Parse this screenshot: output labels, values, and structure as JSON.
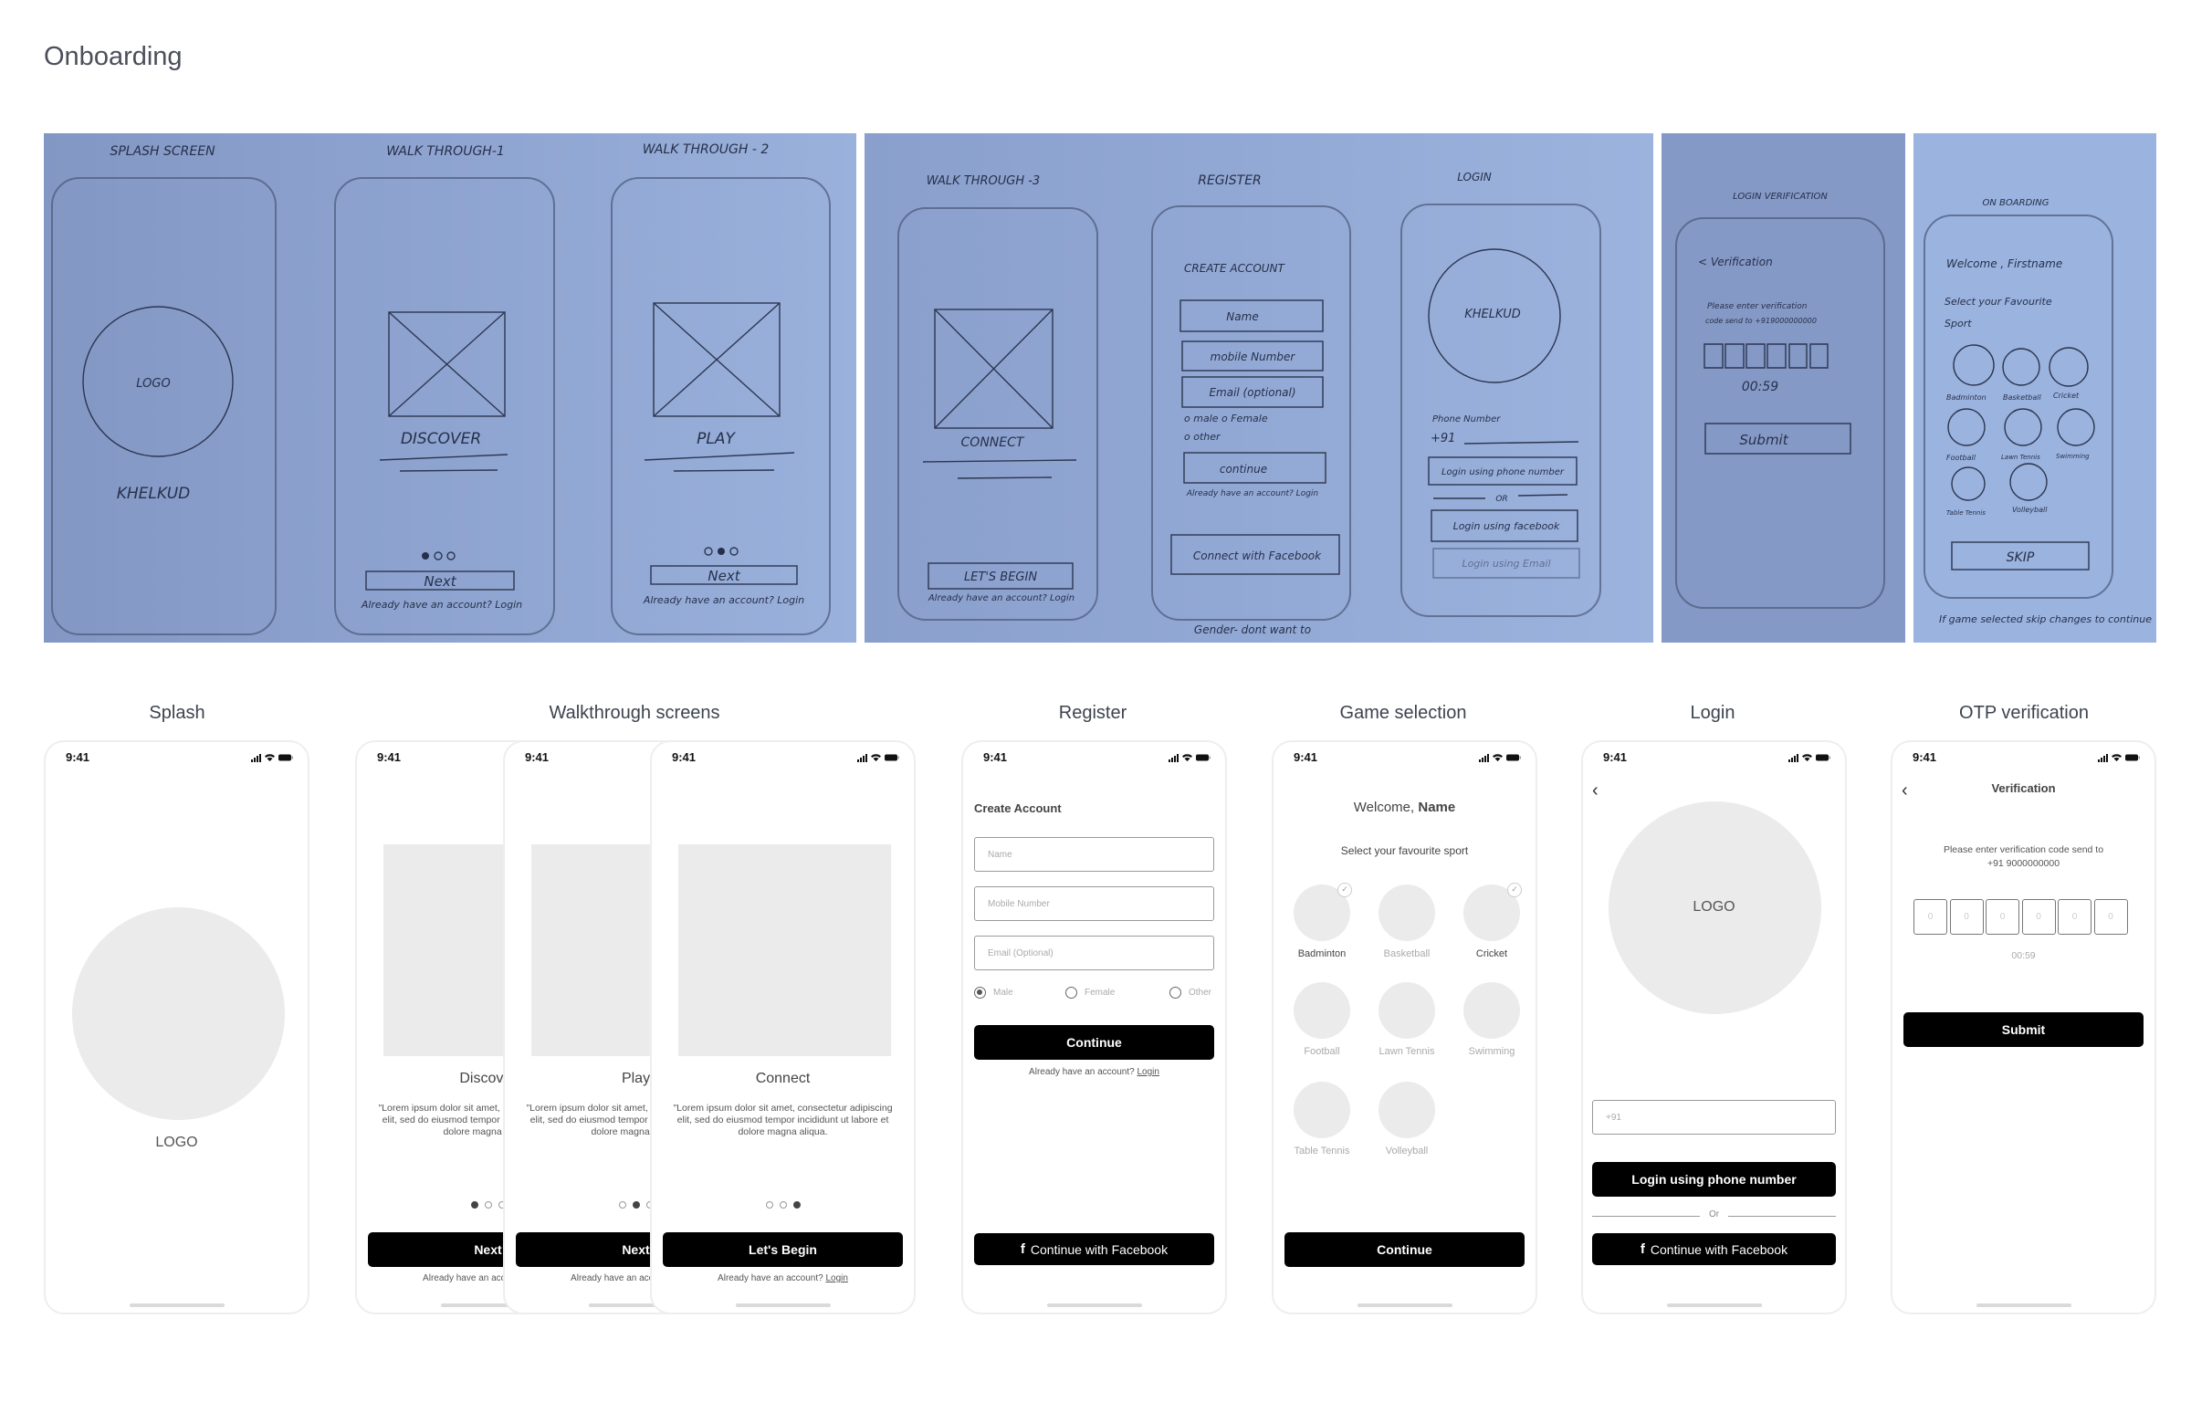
{
  "page_title": "Onboarding",
  "sketches": {
    "panel1": {
      "splash": {
        "title": "SPLASH SCREEN",
        "logo": "LOGO",
        "brand": "KHELKUD"
      },
      "walk1": {
        "title": "WALK THROUGH-1",
        "heading": "DISCOVER",
        "button": "Next",
        "footer": "Already have an account? Login"
      },
      "walk2": {
        "title": "WALK THROUGH - 2",
        "heading": "PLAY",
        "button": "Next",
        "footer": "Already have an account? Login"
      }
    },
    "panel2": {
      "walk3": {
        "title": "WALK THROUGH -3",
        "heading": "CONNECT",
        "button": "LET'S BEGIN",
        "footer": "Already have an account? Login"
      },
      "register": {
        "title": "REGISTER",
        "heading": "CREATE ACCOUNT",
        "name": "Name",
        "mobile": "mobile Number",
        "email": "Email (optional)",
        "gender1": "o male    o Female",
        "gender2": "o other",
        "continue": "continue",
        "footer": "Already have an account? Login",
        "facebook": "Connect with Facebook",
        "note": "Gender- dont want to"
      },
      "login": {
        "title": "LOGIN",
        "brand": "KHELKUD",
        "phone_label": "Phone Number",
        "prefix": "+91",
        "phone_button": "Login using phone number",
        "or": "OR",
        "facebook": "Login using facebook",
        "email": "Login using Email"
      }
    },
    "panel3": {
      "title": "LOGIN VERIFICATION",
      "heading": "< Verification",
      "line1": "Please enter verification",
      "line2": "code send to +919000000000",
      "timer": "00:59",
      "button": "Submit"
    },
    "panel4": {
      "title": "ON BOARDING",
      "welcome": "Welcome , Firstname",
      "select1": "Select your Favourite",
      "select2": "Sport",
      "sports": [
        "Badminton",
        "Basketball",
        "Cricket",
        "Football",
        "Lawn Tennis",
        "Swimming",
        "Table Tennis",
        "Volleyball"
      ],
      "button": "SKIP",
      "note": "If game selected skip changes to continue"
    }
  },
  "sections": {
    "splash": "Splash",
    "walkthrough": "Walkthrough screens",
    "register": "Register",
    "game": "Game selection",
    "login": "Login",
    "otp": "OTP verification"
  },
  "status_time": "9:41",
  "splash": {
    "logo": "LOGO"
  },
  "walkthrough": [
    {
      "title": "Discover",
      "body": "\"Lorem ipsum dolor sit amet, consectetur adipiscing elit, sed do eiusmod tempor incididunt ut labore et dolore magna aliqua.",
      "button": "Next",
      "active_dot": 1
    },
    {
      "title": "Play",
      "body": "\"Lorem ipsum dolor sit amet, consectetur adipiscing elit, sed do eiusmod tempor incididunt ut labore et dolore magna aliqua.",
      "button": "Next",
      "active_dot": 2
    },
    {
      "title": "Connect",
      "body": "\"Lorem ipsum dolor sit amet, consectetur adipiscing elit, sed do eiusmod tempor incididunt ut labore et dolore magna aliqua.",
      "button": "Let's Begin",
      "active_dot": 3
    }
  ],
  "account_prompt": "Already have an account?",
  "login_link": "Login",
  "register": {
    "heading": "Create Account",
    "name_placeholder": "Name",
    "mobile_placeholder": "Mobile Number",
    "email_placeholder": "Email (Optional)",
    "genders": [
      "Male",
      "Female",
      "Other"
    ],
    "selected_gender": "Male",
    "continue": "Continue",
    "facebook": "Continue with Facebook"
  },
  "game": {
    "welcome": "Welcome, ",
    "name": "Name",
    "subtitle": "Select your favourite sport",
    "sports": [
      "Badminton",
      "Basketball",
      "Cricket",
      "Football",
      "Lawn Tennis",
      "Swimming",
      "Table Tennis",
      "Volleyball"
    ],
    "selected": [
      "Badminton",
      "Cricket"
    ],
    "continue": "Continue"
  },
  "login": {
    "logo": "LOGO",
    "phone_placeholder": "+91",
    "phone_button": "Login using phone number",
    "or": "Or",
    "facebook": "Continue with Facebook"
  },
  "otp": {
    "title": "Verification",
    "line1": "Please enter verification code send to",
    "line2": "+91 9000000000",
    "digits": [
      "0",
      "0",
      "0",
      "0",
      "0",
      "0"
    ],
    "timer": "00:59",
    "submit": "Submit"
  },
  "colors": {
    "sketch_blue": "#93abd8",
    "placeholder": "#ebebeb",
    "button": "#000000"
  }
}
